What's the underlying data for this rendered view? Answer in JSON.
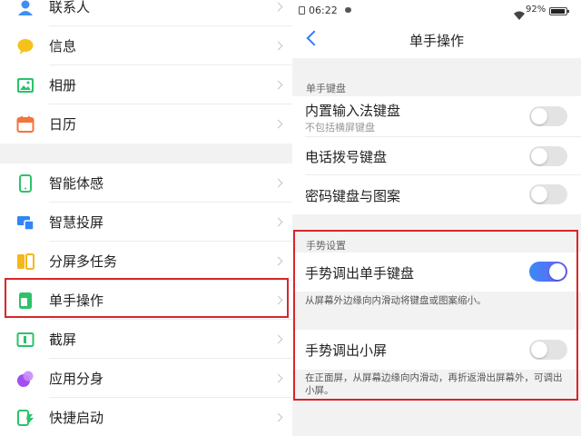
{
  "left_menu": {
    "items": [
      {
        "label": "联系人",
        "icon": "contacts-icon",
        "color": "#3f8ef5"
      },
      {
        "label": "信息",
        "icon": "message-icon",
        "color": "#f6c21a"
      },
      {
        "label": "相册",
        "icon": "album-icon",
        "color": "#2cc26a"
      },
      {
        "label": "日历",
        "icon": "calendar-icon",
        "color": "#f4743a"
      },
      {
        "label": "智能体感",
        "icon": "motion-sense-icon",
        "color": "#2cc26a"
      },
      {
        "label": "智慧投屏",
        "icon": "screen-cast-icon",
        "color": "#2f86f6"
      },
      {
        "label": "分屏多任务",
        "icon": "split-screen-icon",
        "color": "#f6b71a"
      },
      {
        "label": "单手操作",
        "icon": "one-hand-icon",
        "color": "#2cc26a"
      },
      {
        "label": "截屏",
        "icon": "screenshot-icon",
        "color": "#2cc26a"
      },
      {
        "label": "应用分身",
        "icon": "app-clone-icon",
        "color": "#a34ff0"
      },
      {
        "label": "快捷启动",
        "icon": "quick-launch-icon",
        "color": "#2cc26a"
      }
    ],
    "highlight_color": "#d9252a"
  },
  "status_bar": {
    "time": "06:22",
    "battery": "92%"
  },
  "header": {
    "title": "单手操作",
    "accent": "#2f7cf6"
  },
  "keyboard_section": {
    "title": "单手键盘",
    "rows": [
      {
        "label": "内置输入法键盘",
        "sub": "不包括横屏键盘",
        "on": false
      },
      {
        "label": "电话拨号键盘",
        "on": false
      },
      {
        "label": "密码键盘与图案",
        "on": false
      }
    ]
  },
  "gesture_section": {
    "title": "手势设置",
    "row1": {
      "label": "手势调出单手键盘",
      "on": true,
      "desc": "从屏幕外边缘向内滑动将键盘或图案缩小。"
    },
    "row2": {
      "label": "手势调出小屏",
      "on": false,
      "desc": "在正面屏，从屏幕边缘向内滑动，再折返滑出屏幕外，可调出小屏。"
    }
  }
}
